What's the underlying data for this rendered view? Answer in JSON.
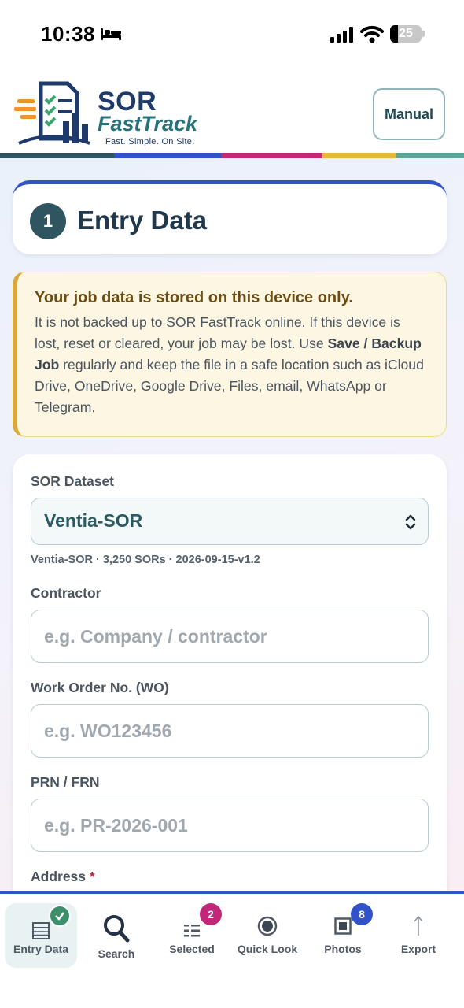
{
  "status_bar": {
    "time": "10:38",
    "battery": "25",
    "battery_level": 0.25
  },
  "header": {
    "logo_name": "SOR",
    "logo_sub": "FastTrack",
    "logo_tagline": "Fast. Simple. On Site.",
    "manual_label": "Manual"
  },
  "stripe_colors": [
    "#2e5560",
    "#3152c9",
    "#c0287a",
    "#e8b73a",
    "#5aa89a"
  ],
  "section": {
    "step": "1",
    "title": "Entry Data"
  },
  "warning": {
    "title": "Your job data is stored on this device only.",
    "body_before": "It is not backed up to SOR FastTrack online. If this device is lost, reset or cleared, your job may be lost. Use ",
    "body_bold": "Save / Backup Job",
    "body_after": " regularly and keep the file in a safe location such as iCloud Drive, OneDrive, Google Drive, Files, email, WhatsApp or Telegram."
  },
  "form": {
    "dataset_label": "SOR Dataset",
    "dataset_value": "Ventia-SOR",
    "dataset_meta": "Ventia-SOR · 3,250 SORs · 2026-09-15-v1.2",
    "contractor_label": "Contractor",
    "contractor_placeholder": "e.g. Company / contractor",
    "wo_label": "Work Order No. (WO)",
    "wo_placeholder": "e.g. WO123456",
    "prn_label": "PRN / FRN",
    "prn_placeholder": "e.g. PR-2026-001",
    "address_label": "Address",
    "address_required": "*"
  },
  "nav": {
    "entry_data": "Entry Data",
    "search": "Search",
    "selected": "Selected",
    "selected_count": "2",
    "quick_look": "Quick Look",
    "photos": "Photos",
    "photos_count": "8",
    "export": "Export"
  },
  "colors": {
    "accent_blue": "#3152c9",
    "teal": "#2e5560",
    "badge_pink": "#c0287a",
    "check_green": "#3d8f6a"
  }
}
